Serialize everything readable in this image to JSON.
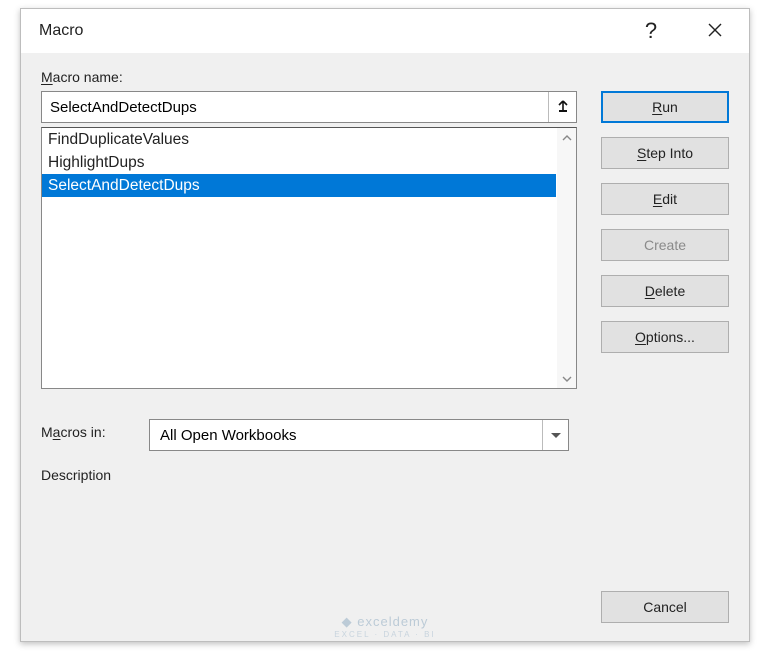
{
  "title": "Macro",
  "labels": {
    "macro_name_pre": "M",
    "macro_name_rest": "acro name:",
    "macros_in_pre": "M",
    "macros_in_u": "a",
    "macros_in_rest": "cros in:",
    "description": "Description"
  },
  "macro_name_value": "SelectAndDetectDups",
  "macro_list": [
    {
      "label": "FindDuplicateValues",
      "selected": false
    },
    {
      "label": "HighlightDups",
      "selected": false
    },
    {
      "label": "SelectAndDetectDups",
      "selected": true
    }
  ],
  "macros_in_value": "All Open Workbooks",
  "buttons": {
    "run_u": "R",
    "run_rest": "un",
    "step_u": "S",
    "step_rest": "tep Into",
    "edit_u": "E",
    "edit_rest": "dit",
    "create": "Create",
    "delete_u": "D",
    "delete_rest": "elete",
    "options_u": "O",
    "options_rest": "ptions...",
    "cancel": "Cancel"
  },
  "watermark": {
    "main": "exceldemy",
    "sub": "EXCEL · DATA · BI"
  }
}
